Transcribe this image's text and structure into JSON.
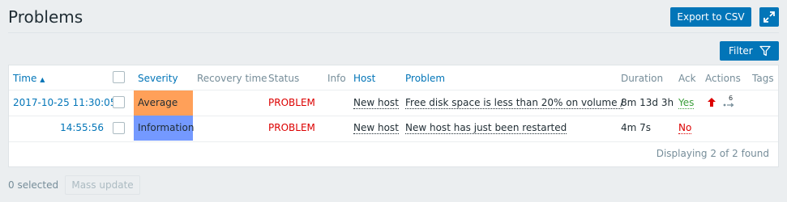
{
  "header": {
    "title": "Problems",
    "export_label": "Export to CSV",
    "filter_label": "Filter"
  },
  "table": {
    "headers": {
      "time": "Time",
      "severity": "Severity",
      "recovery": "Recovery time",
      "status": "Status",
      "info": "Info",
      "host": "Host",
      "problem": "Problem",
      "duration": "Duration",
      "ack": "Ack",
      "actions": "Actions",
      "tags": "Tags"
    },
    "sort_indicator": "▲",
    "rows": [
      {
        "time": "2017-10-25 11:30:05",
        "severity": "Average",
        "severity_color": "#ffa059",
        "status": "PROBLEM",
        "host": "New host",
        "problem": "Free disk space is less than 20% on volume /",
        "duration": "8m 13d 3h",
        "ack": "Yes",
        "actions_count": "6"
      },
      {
        "time": "14:55:56",
        "severity": "Information",
        "severity_color": "#7499ff",
        "status": "PROBLEM",
        "host": "New host",
        "problem": "New host has just been restarted",
        "duration": "4m 7s",
        "ack": "No"
      }
    ],
    "footer": "Displaying 2 of 2 found"
  },
  "bottom": {
    "selected": "0 selected",
    "mass_update": "Mass update"
  },
  "colors": {
    "accent": "#0275b8",
    "problem": "#dc0000",
    "ack_yes": "#3b9e3b"
  }
}
